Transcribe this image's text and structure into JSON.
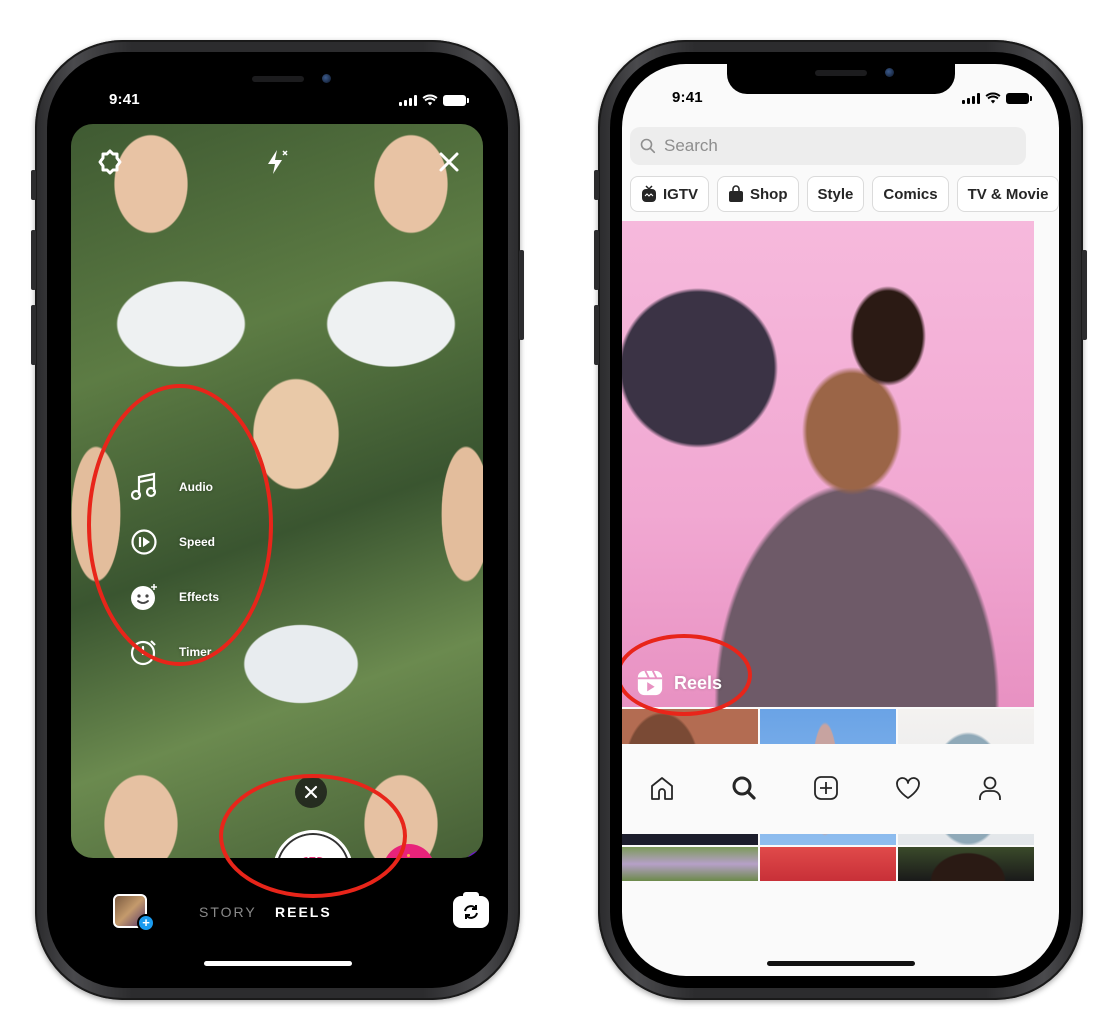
{
  "left_phone": {
    "status_bar": {
      "time": "9:41"
    },
    "camera_top_icons": [
      "gear-icon",
      "flash-off-icon",
      "close-icon"
    ],
    "tools": [
      {
        "label": "Audio",
        "icon": "music-note-icon"
      },
      {
        "label": "Speed",
        "icon": "speed-play-icon"
      },
      {
        "label": "Effects",
        "icon": "effects-face-icon"
      },
      {
        "label": "Timer",
        "icon": "timer-icon"
      }
    ],
    "shutter_icon": "reels-icon",
    "effect_close_icon": "close-icon",
    "modes": {
      "story": "STORY",
      "reels": "REELS",
      "active": "REELS"
    },
    "gallery_plus": "+",
    "flip_camera_icon": "flip-camera-icon"
  },
  "right_phone": {
    "status_bar": {
      "time": "9:41"
    },
    "search": {
      "placeholder": "Search"
    },
    "chips": [
      {
        "label": "IGTV",
        "icon": "igtv-icon"
      },
      {
        "label": "Shop",
        "icon": "shopping-bag-icon"
      },
      {
        "label": "Style"
      },
      {
        "label": "Comics"
      },
      {
        "label": "TV & Movie"
      }
    ],
    "hero_badge": {
      "label": "Reels",
      "icon": "reels-icon"
    },
    "tabbar": [
      "home-icon",
      "search-icon",
      "new-post-icon",
      "heart-icon",
      "profile-icon"
    ],
    "active_tab": "search-icon"
  },
  "colors": {
    "highlight_ring": "#e8251a",
    "reels_gradient_start": "#e83a7a",
    "reels_gradient_end": "#f9a825",
    "add_badge": "#1a9bf0"
  }
}
